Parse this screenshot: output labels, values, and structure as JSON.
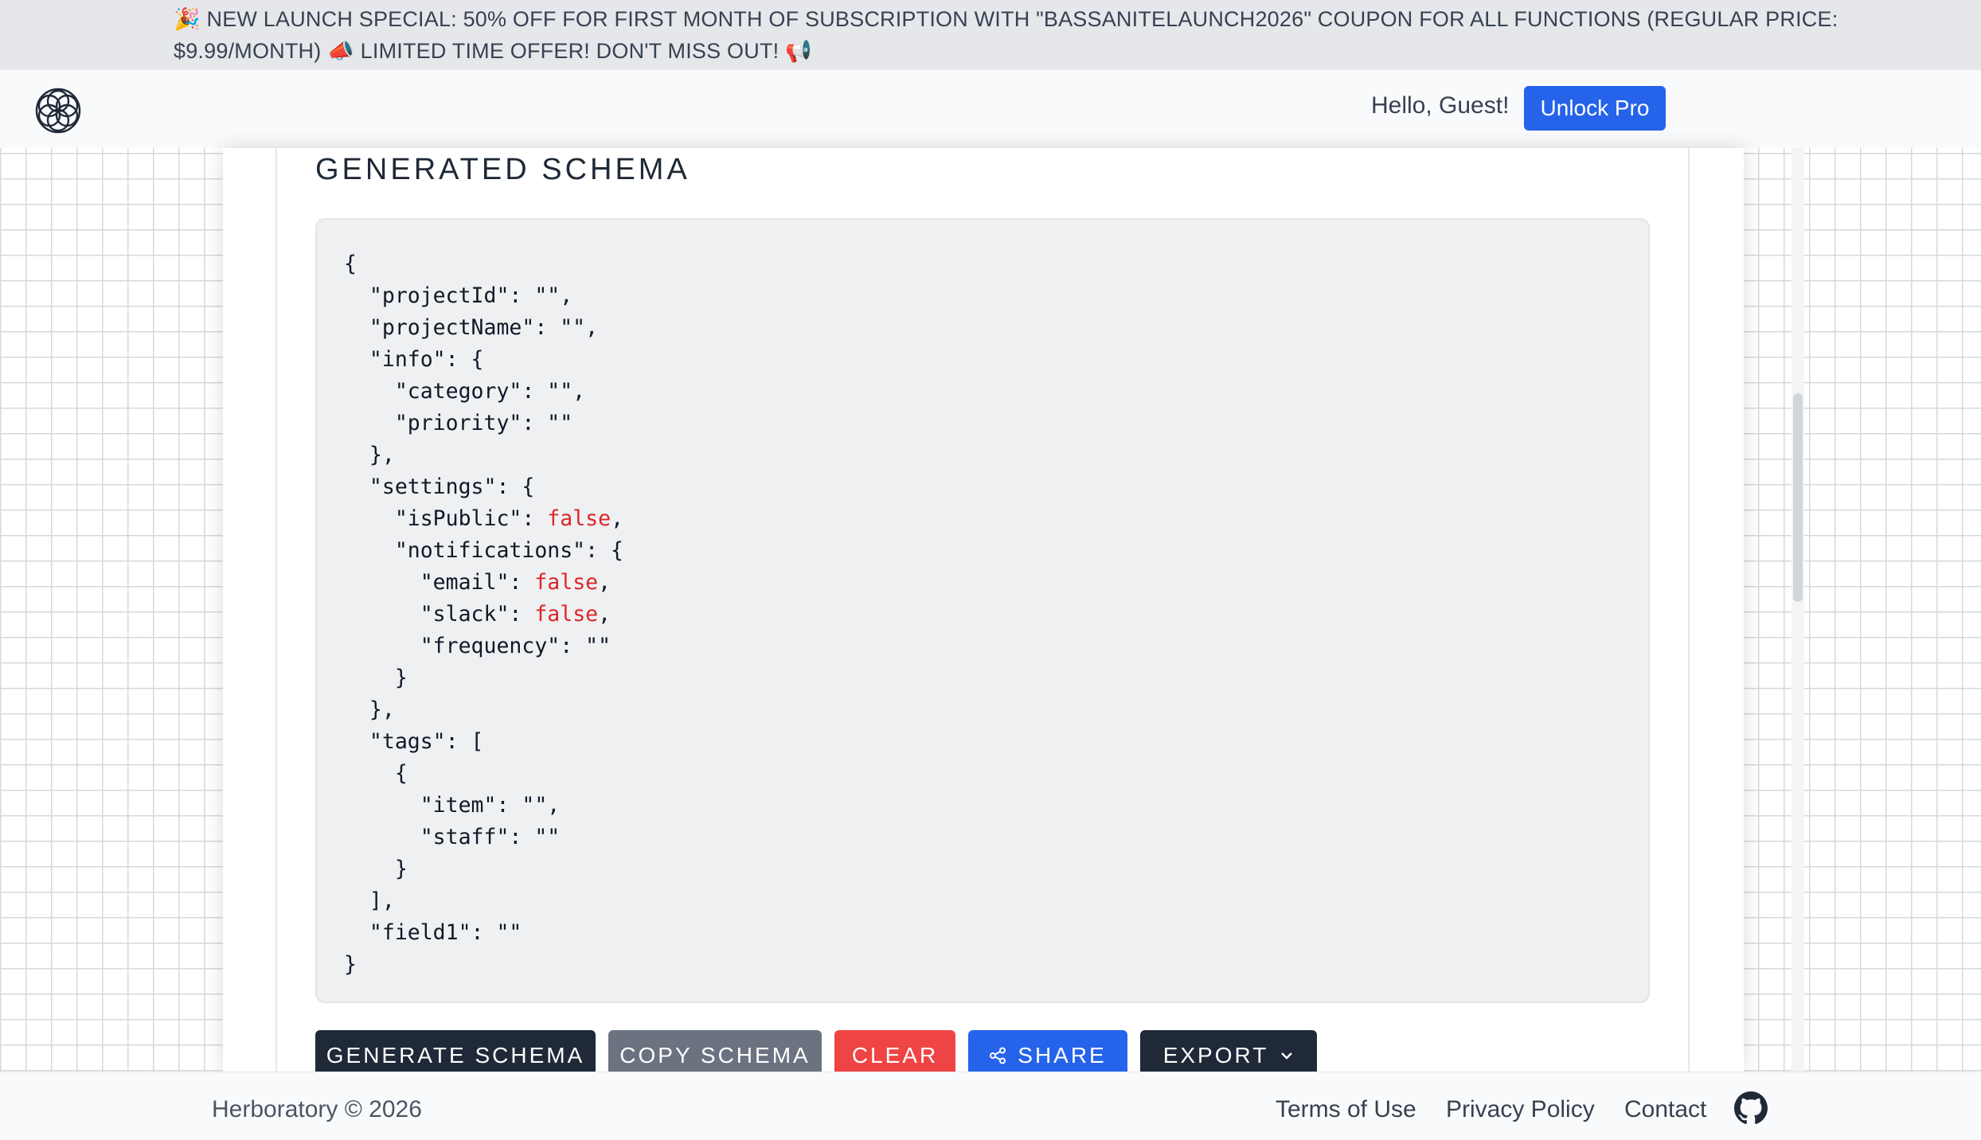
{
  "banner": {
    "text": "🎉 NEW LAUNCH SPECIAL: 50% OFF FOR FIRST MONTH OF SUBSCRIPTION WITH \"BASSANITELAUNCH2026\" COUPON FOR ALL FUNCTIONS   (REGULAR PRICE: $9.99/MONTH) 📣 LIMITED TIME OFFER! DON'T MISS OUT! 📢"
  },
  "navbar": {
    "logo_icon": "flower-of-life-logo-icon",
    "greeting": "Hello, Guest!",
    "unlock_label": "Unlock Pro",
    "unlock_color": "#2563eb"
  },
  "schema_section": {
    "title": "GENERATED SCHEMA",
    "code_lines": [
      "{",
      "  \"projectId\": \"\",",
      "  \"projectName\": \"\",",
      "  \"info\": {",
      "    \"category\": \"\",",
      "    \"priority\": \"\"",
      "  },",
      "  \"settings\": {",
      "    \"isPublic\": false,",
      "    \"notifications\": {",
      "      \"email\": false,",
      "      \"slack\": false,",
      "      \"frequency\": \"\"",
      "    }",
      "  },",
      "  \"tags\": [",
      "    {",
      "      \"item\": \"\",",
      "      \"staff\": \"\"",
      "    }",
      "  ],",
      "  \"field1\": \"\"",
      "}"
    ],
    "keyword_color": "#dc2626"
  },
  "actions": {
    "generate_label": "GENERATE SCHEMA",
    "copy_label": "COPY SCHEMA",
    "clear_label": "CLEAR",
    "share_label": "SHARE",
    "share_icon": "share-icon",
    "export_label": "EXPORT",
    "export_icon": "chevron-down-icon"
  },
  "footer": {
    "copyright": "Herboratory © 2026",
    "links": [
      "Terms of Use",
      "Privacy Policy",
      "Contact"
    ],
    "github_icon": "github-icon"
  }
}
